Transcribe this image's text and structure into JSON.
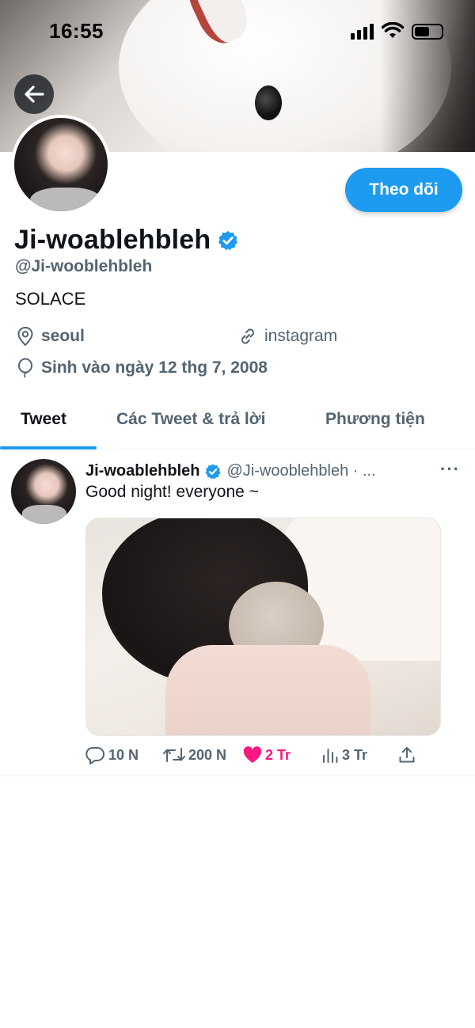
{
  "status_bar": {
    "time": "16:55"
  },
  "profile": {
    "display_name": "Ji-woablehbleh",
    "handle": "@Ji-wooblehbleh",
    "bio": "SOLACE",
    "location": "seoul",
    "website": "instagram",
    "birthday": "Sinh vào ngày 12 thg 7, 2008",
    "follow_label": "Theo dõi"
  },
  "tabs": [
    {
      "label": "Tweet",
      "active": true
    },
    {
      "label": "Các Tweet & trả lời",
      "active": false
    },
    {
      "label": "Phương tiện",
      "active": false
    }
  ],
  "tweet": {
    "name": "Ji-woablehbleh",
    "handle": "@Ji-wooblehbleh · ...",
    "more": "···",
    "text": "Good night! everyone ~",
    "replies": "10 N",
    "retweets": "200 N",
    "likes": "2 Tr",
    "views": "3 Tr"
  },
  "colors": {
    "accent": "#1d9bf0",
    "like": "#f91880",
    "secondary_text": "#536471"
  },
  "icons": [
    "back-arrow-icon",
    "verified-badge-icon",
    "location-pin-icon",
    "link-icon",
    "balloon-icon",
    "reply-icon",
    "retweet-icon",
    "heart-icon",
    "views-icon",
    "share-icon"
  ]
}
